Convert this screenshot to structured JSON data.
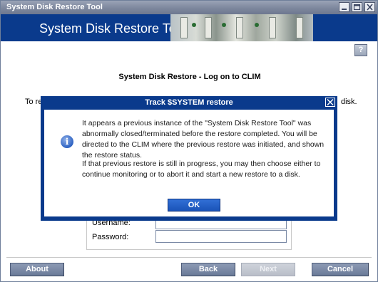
{
  "window": {
    "title": "System Disk Restore Tool"
  },
  "banner": {
    "title": "System Disk Restore Tool"
  },
  "help_label": "?",
  "page": {
    "heading": "System Disk Restore - Log on to CLIM",
    "intro_left": "To re",
    "intro_right": "disk."
  },
  "form": {
    "username_label": "Username:",
    "username_value": "",
    "password_label": "Password:",
    "password_value": ""
  },
  "footer": {
    "about": "About",
    "back": "Back",
    "next": "Next",
    "cancel": "Cancel"
  },
  "dialog": {
    "title": "Track $SYSTEM restore",
    "paragraph1": "It appears a previous instance of the \"System Disk Restore Tool\" was abnormally closed/terminated before the restore completed. You will be directed to the CLIM where the previous restore was initiated, and shown the restore status.",
    "paragraph2": "If that previous restore is still in progress, you may then choose either to continue monitoring or to abort it and start a new restore to a disk.",
    "ok": "OK"
  },
  "icons": {
    "minimize": "minimize-icon",
    "maximize": "maximize-icon",
    "close": "close-icon",
    "info": "info-icon",
    "help": "help-icon"
  },
  "colors": {
    "banner": "#0a3a8c",
    "titlebar": "#7d879d",
    "button": "#6a7a98",
    "ok_button": "#1a53b8"
  }
}
